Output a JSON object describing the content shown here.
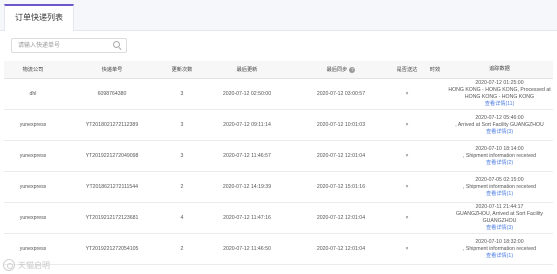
{
  "tab": {
    "title": "订单快递列表"
  },
  "search": {
    "placeholder": "请输入快递单号"
  },
  "columns": [
    "物流公司",
    "快递单号",
    "更新次数",
    "最后更新",
    "最后同步",
    "是否送达",
    "时效",
    "追踪数据"
  ],
  "rows": [
    {
      "company": "dhl",
      "tracking_no": "6098764380",
      "updates": "3",
      "last_update": "2020-07-12 02:50:00",
      "last_sync": "2020-07-12 03:00:57",
      "delivered": "×",
      "timing": "",
      "track_lines": [
        "2020-07-12 01:25:00",
        "HONG KONG - HONG KONG, Processed at",
        "HONG KONG - HONG KONG"
      ],
      "track_link": "查看详情(11)"
    },
    {
      "company": "yunexpress",
      "tracking_no": "YT2018021272112389",
      "updates": "3",
      "last_update": "2020-07-12 09:11:14",
      "last_sync": "2020-07-12 10:01:03",
      "delivered": "×",
      "timing": "",
      "track_lines": [
        "2020-07-12 05:46:00",
        ", Arrived at Sort Facility GUANGZHOU"
      ],
      "track_link": "查看详情(3)"
    },
    {
      "company": "yunexpress",
      "tracking_no": "YT2019221272049098",
      "updates": "3",
      "last_update": "2020-07-12 11:46:57",
      "last_sync": "2020-07-12 12:01:04",
      "delivered": "×",
      "timing": "",
      "track_lines": [
        "2020-07-10 18:14:00",
        ", Shipment information received"
      ],
      "track_link": "查看详情(2)"
    },
    {
      "company": "yunexpress",
      "tracking_no": "YT2018621272111544",
      "updates": "2",
      "last_update": "2020-07-12 14:19:39",
      "last_sync": "2020-07-12 15:01:16",
      "delivered": "×",
      "timing": "",
      "track_lines": [
        "2020-07-05 02:15:00",
        ", Shipment information received"
      ],
      "track_link": "查看详情(1)"
    },
    {
      "company": "yunexpress",
      "tracking_no": "YT2019212172123681",
      "updates": "4",
      "last_update": "2020-07-12 11:47:16",
      "last_sync": "2020-07-12 12:01:04",
      "delivered": "×",
      "timing": "",
      "track_lines": [
        "2020-07-11 21:44:17",
        "GUANGZHOU, Arrived at Sort Facility",
        "GUANGZHOU"
      ],
      "track_link": "查看详情(3)"
    },
    {
      "company": "yunexpress",
      "tracking_no": "YT2019221272054105",
      "updates": "2",
      "last_update": "2020-07-12 11:46:50",
      "last_sync": "2020-07-12 12:01:04",
      "delivered": "×",
      "timing": "",
      "track_lines": [
        "2020-07-10 18:32:00",
        ", Shipment information received"
      ],
      "track_link": "查看详情(1)"
    }
  ],
  "watermark": {
    "text": "天猫启明"
  },
  "icons": {
    "search": "search-icon",
    "info": "info-icon"
  },
  "colors": {
    "accent": "#6e57c8",
    "link": "#4a7be0"
  }
}
